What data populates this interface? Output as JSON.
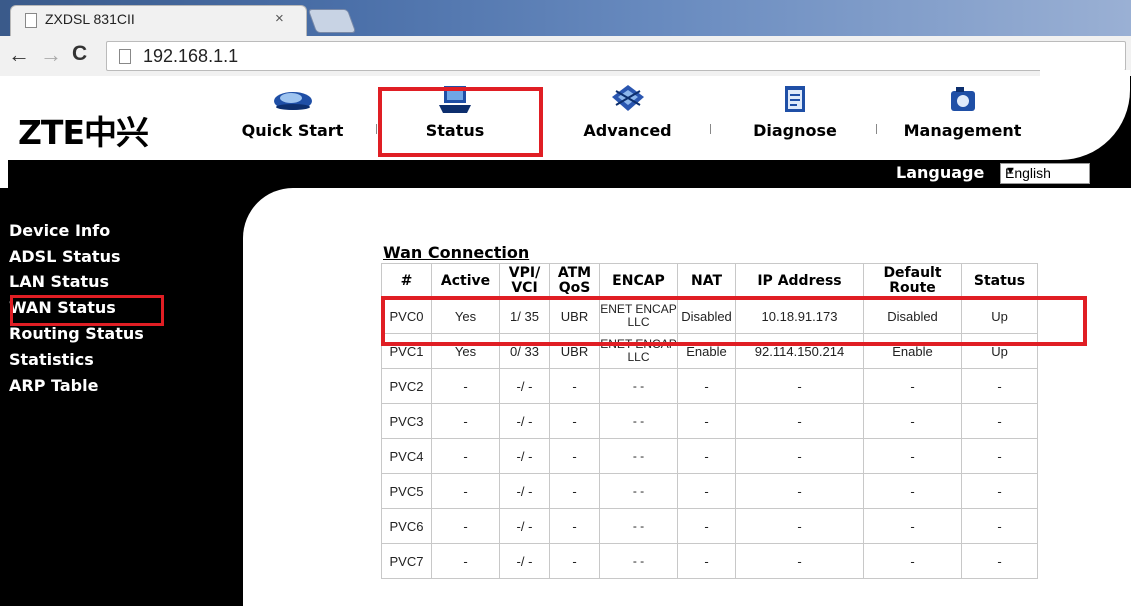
{
  "browser": {
    "tab_title": "ZXDSL 831CII",
    "tab_close": "×",
    "url": "192.168.1.1"
  },
  "logo": {
    "text": "ZTE中兴"
  },
  "nav": [
    {
      "label": "Quick Start",
      "icon": "car-icon"
    },
    {
      "label": "Status",
      "icon": "laptop-icon"
    },
    {
      "label": "Advanced",
      "icon": "chip-icon"
    },
    {
      "label": "Diagnose",
      "icon": "clipboard-icon"
    },
    {
      "label": "Management",
      "icon": "camera-icon"
    }
  ],
  "language": {
    "label": "Language",
    "selected": "English"
  },
  "sidebar": {
    "items": [
      "Device Info",
      "ADSL Status",
      "LAN Status",
      "WAN Status",
      "Routing Status",
      "Statistics",
      "ARP Table"
    ]
  },
  "table": {
    "title": "Wan Connection",
    "headers": [
      "#",
      "Active",
      "VPI/ VCI",
      "ATM QoS",
      "ENCAP",
      "NAT",
      "IP Address",
      "Default Route",
      "Status"
    ],
    "rows": [
      [
        "PVC0",
        "Yes",
        "1/ 35",
        "UBR",
        "ENET ENCAP LLC",
        "Disabled",
        "10.18.91.173",
        "Disabled",
        "Up"
      ],
      [
        "PVC1",
        "Yes",
        "0/ 33",
        "UBR",
        "ENET ENCAP LLC",
        "Enable",
        "92.114.150.214",
        "Enable",
        "Up"
      ],
      [
        "PVC2",
        "-",
        "-/ -",
        "-",
        "- -",
        "-",
        "-",
        "-",
        "-"
      ],
      [
        "PVC3",
        "-",
        "-/ -",
        "-",
        "- -",
        "-",
        "-",
        "-",
        "-"
      ],
      [
        "PVC4",
        "-",
        "-/ -",
        "-",
        "- -",
        "-",
        "-",
        "-",
        "-"
      ],
      [
        "PVC5",
        "-",
        "-/ -",
        "-",
        "- -",
        "-",
        "-",
        "-",
        "-"
      ],
      [
        "PVC6",
        "-",
        "-/ -",
        "-",
        "- -",
        "-",
        "-",
        "-",
        "-"
      ],
      [
        "PVC7",
        "-",
        "-/ -",
        "-",
        "- -",
        "-",
        "-",
        "-",
        "-"
      ]
    ]
  },
  "colors": {
    "highlight": "#e01e24",
    "sidebar_bg": "#000000"
  }
}
